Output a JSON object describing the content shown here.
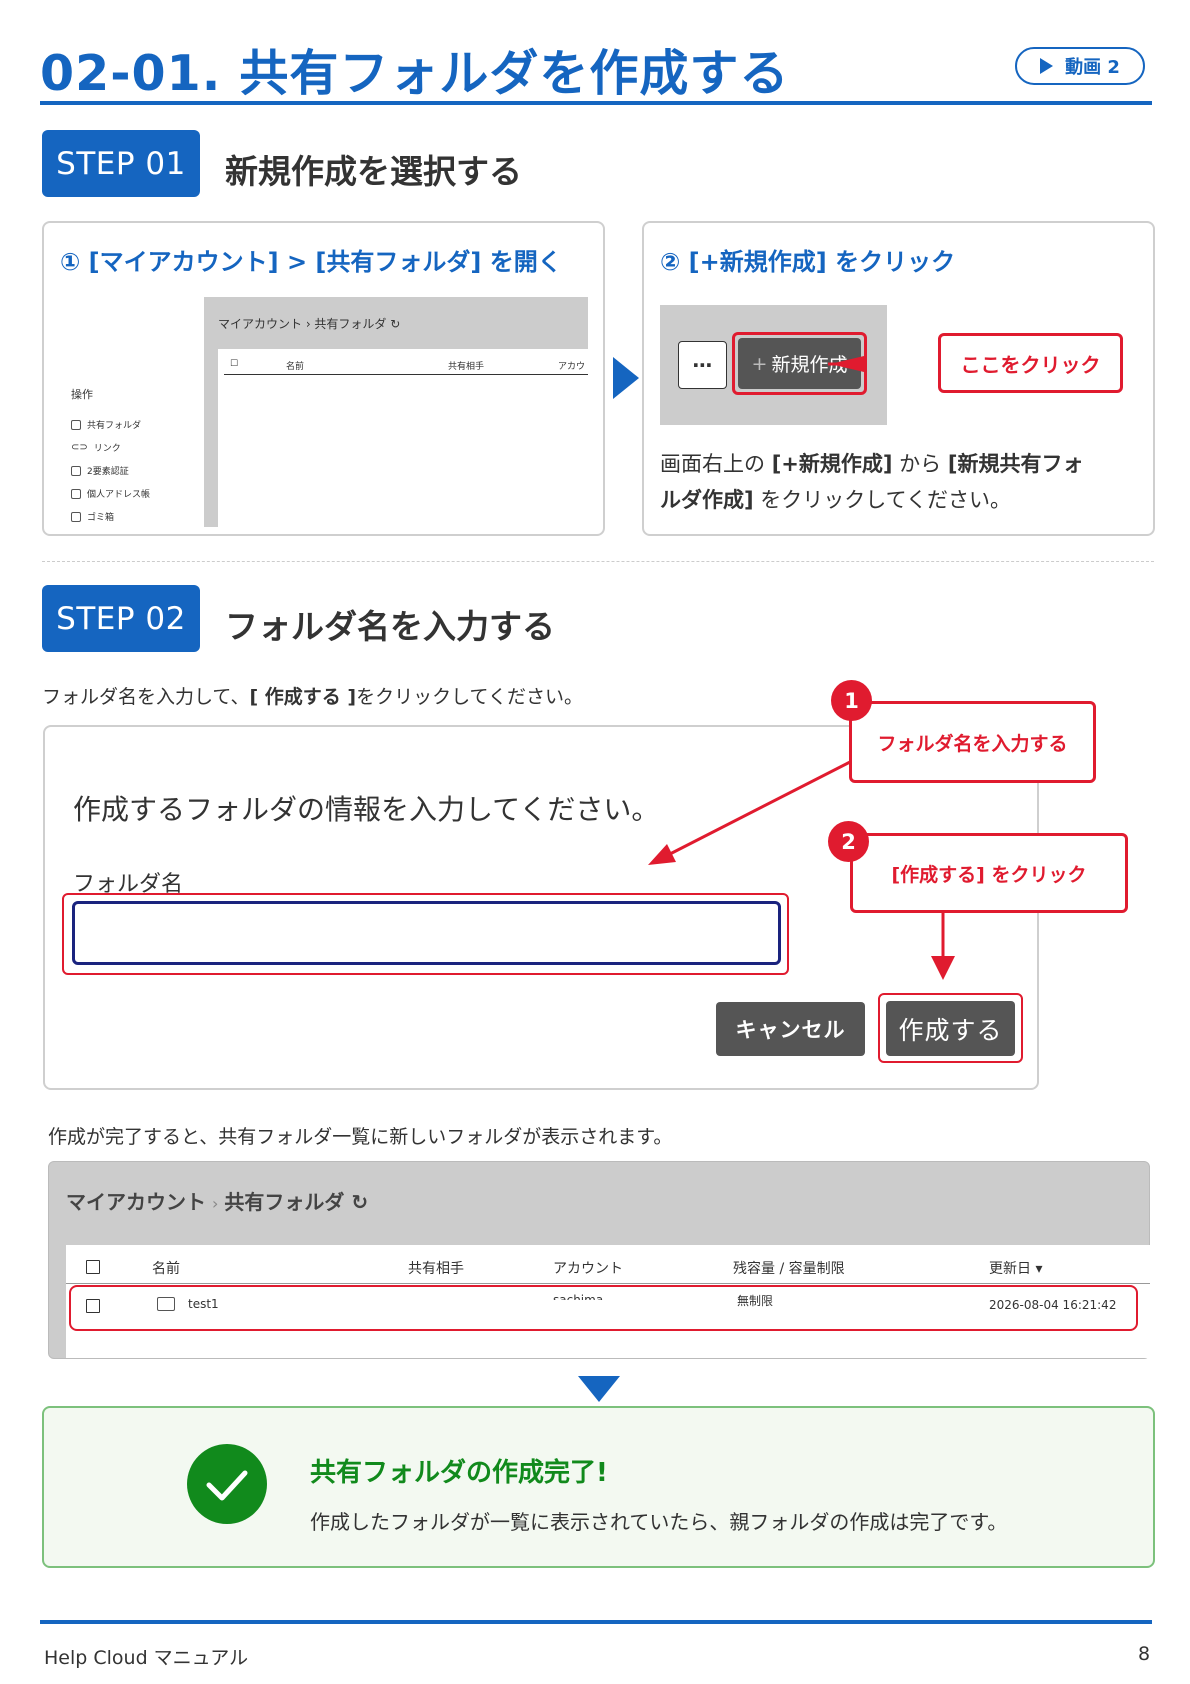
{
  "header": {
    "title": "02-01. 共有フォルダを作成する",
    "video_label": "動画 2"
  },
  "step1": {
    "badge": "STEP 01",
    "title": "新規作成を選択する",
    "left_panel": {
      "title": "① [マイアカウント] > [共有フォルダ] を開く",
      "screenshot": {
        "breadcrumb": "マイアカウント › 共有フォルダ ↻",
        "columns": [
          "名前",
          "共有相手",
          "アカウ"
        ],
        "sidebar_title": "操作",
        "sidebar_items": [
          "共有フォルダ",
          "リンク",
          "2要素認証",
          "個人アドレス帳",
          "ゴミ箱"
        ]
      }
    },
    "right_panel": {
      "title": "② [+新規作成] をクリック",
      "more_label": "⋯",
      "new_button_plus": "+",
      "new_button_label": "新規作成",
      "callout": "ここをクリック",
      "desc_line1_a": "画面右上の",
      "desc_line1_b": "[+新規作成]",
      "desc_line1_c": "から",
      "desc_line1_d": "[新規共有フォ",
      "desc_line2_a": "ルダ作成]",
      "desc_line2_b": "をクリックしてください。"
    }
  },
  "step2": {
    "badge": "STEP 02",
    "title": "フォルダ名を入力する",
    "intro_a": "フォルダ名を入力して、",
    "intro_b": "[ 作成する ]",
    "intro_c": "をクリックしてください。",
    "dialog": {
      "message": "作成するフォルダの情報を入力してください。",
      "field_label": "フォルダ名",
      "field_value": "",
      "cancel_label": "キャンセル",
      "create_label": "作成する"
    },
    "callout1_num": "1",
    "callout1": "フォルダ名を入力する",
    "callout2_num": "2",
    "callout2": "[作成する] をクリック",
    "result_text": "作成が完了すると、共有フォルダ一覧に新しいフォルダが表示されます。",
    "list": {
      "breadcrumb_a": "マイアカウント",
      "breadcrumb_sep": "›",
      "breadcrumb_b": "共有フォルダ ↻",
      "columns": [
        "名前",
        "共有相手",
        "アカウント",
        "残容量 / 容量制限",
        "更新日 ▾"
      ],
      "row": {
        "name": "test1",
        "account": "sachima",
        "capacity": "無制限",
        "updated": "2026-08-04 16:21:42"
      }
    }
  },
  "done": {
    "title": "共有フォルダの作成完了!",
    "text": "作成したフォルダが一覧に表示されていたら、親フォルダの作成は完了です。"
  },
  "footer": {
    "left": "Help Cloud マニュアル",
    "page": "8"
  },
  "colors": {
    "primary": "#1565c0",
    "alert": "#e01b2f",
    "success": "#118a1c"
  }
}
